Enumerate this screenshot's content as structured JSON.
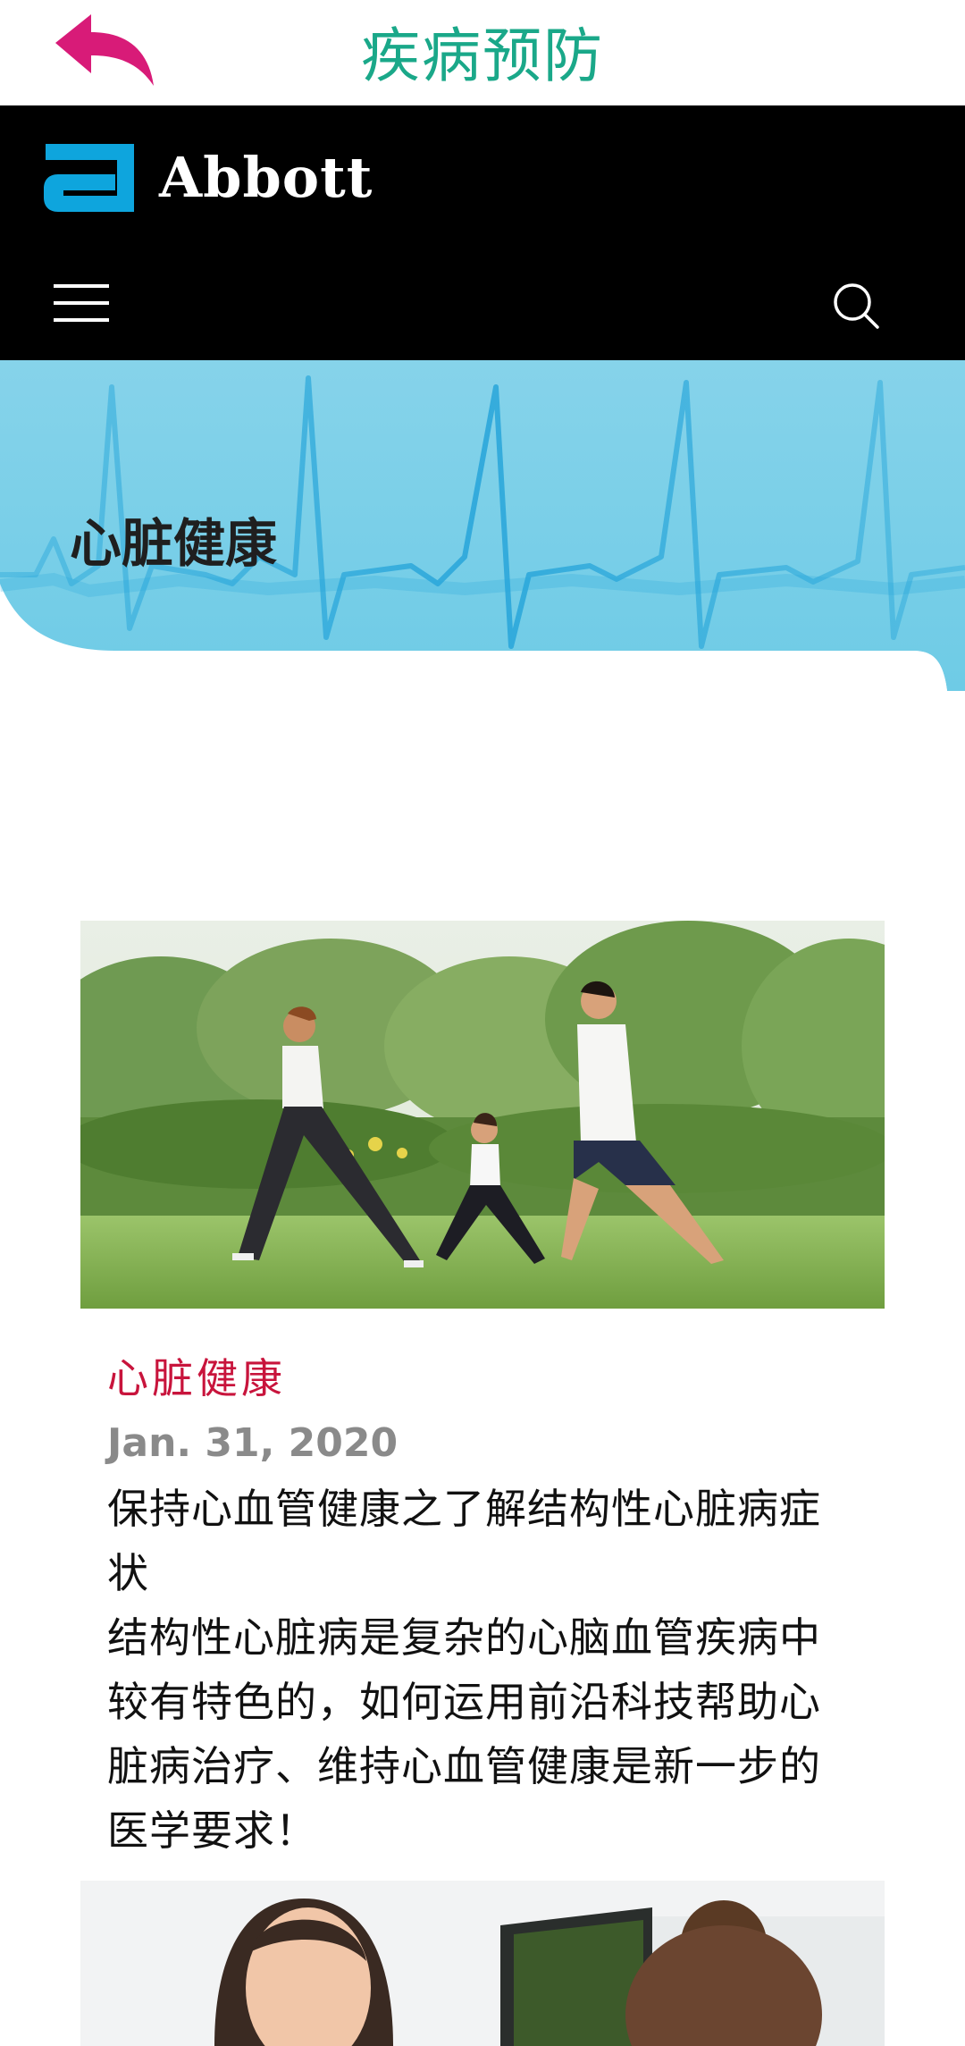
{
  "app_bar": {
    "back_icon": "back-arrow-icon",
    "title": "疾病预防",
    "accent_color": "#1aa889",
    "back_color": "#d81b78"
  },
  "site_header": {
    "logo_text": "Abbott",
    "logo_color": "#0ea5dd",
    "menu_icon": "hamburger-menu-icon",
    "search_icon": "search-icon"
  },
  "hero": {
    "title": "心脏健康",
    "background_color": "#7fd3ea"
  },
  "articles": [
    {
      "image": "family-exercising-outdoors-photo",
      "category": "心脏健康",
      "category_color": "#c8143c",
      "date": "Jan. 31, 2020",
      "headline": "保持心血管健康之了解结构性心脏病症状",
      "summary": "结构性心脏病是复杂的心脑血管疾病中较有特色的，如何运用前沿科技帮助心脏病治疗、维持心血管健康是新一步的医学要求！"
    },
    {
      "image": "women-smiling-photo"
    }
  ]
}
